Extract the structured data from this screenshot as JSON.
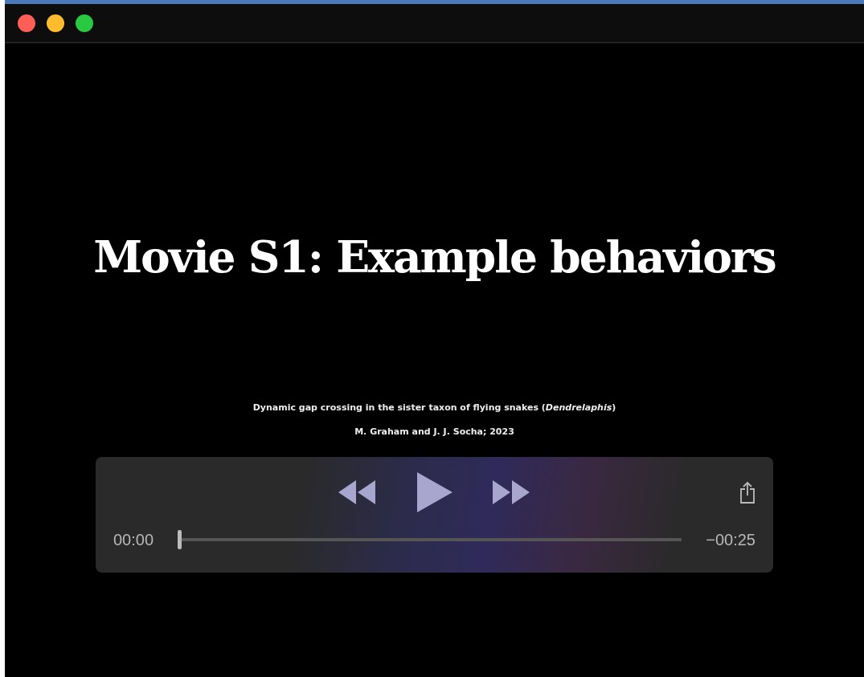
{
  "window": {
    "buttons": [
      {
        "color": "#ff5f57"
      },
      {
        "color": "#febc2e"
      },
      {
        "color": "#28c840"
      }
    ]
  },
  "slide": {
    "title": "Movie S1: Example behaviors",
    "caption": "Dynamic gap crossing in the sister taxon of flying snakes (*Dendrelaphis*)",
    "credit": "M. Graham and J. J. Socha; 2023"
  },
  "controls": {
    "buttons": [
      {
        "kind": "rewind"
      },
      {
        "kind": "play"
      },
      {
        "kind": "fast-forward"
      },
      {
        "kind": "share"
      }
    ],
    "elapsed": "00:00",
    "remaining": "−00:25",
    "level": 0
  }
}
